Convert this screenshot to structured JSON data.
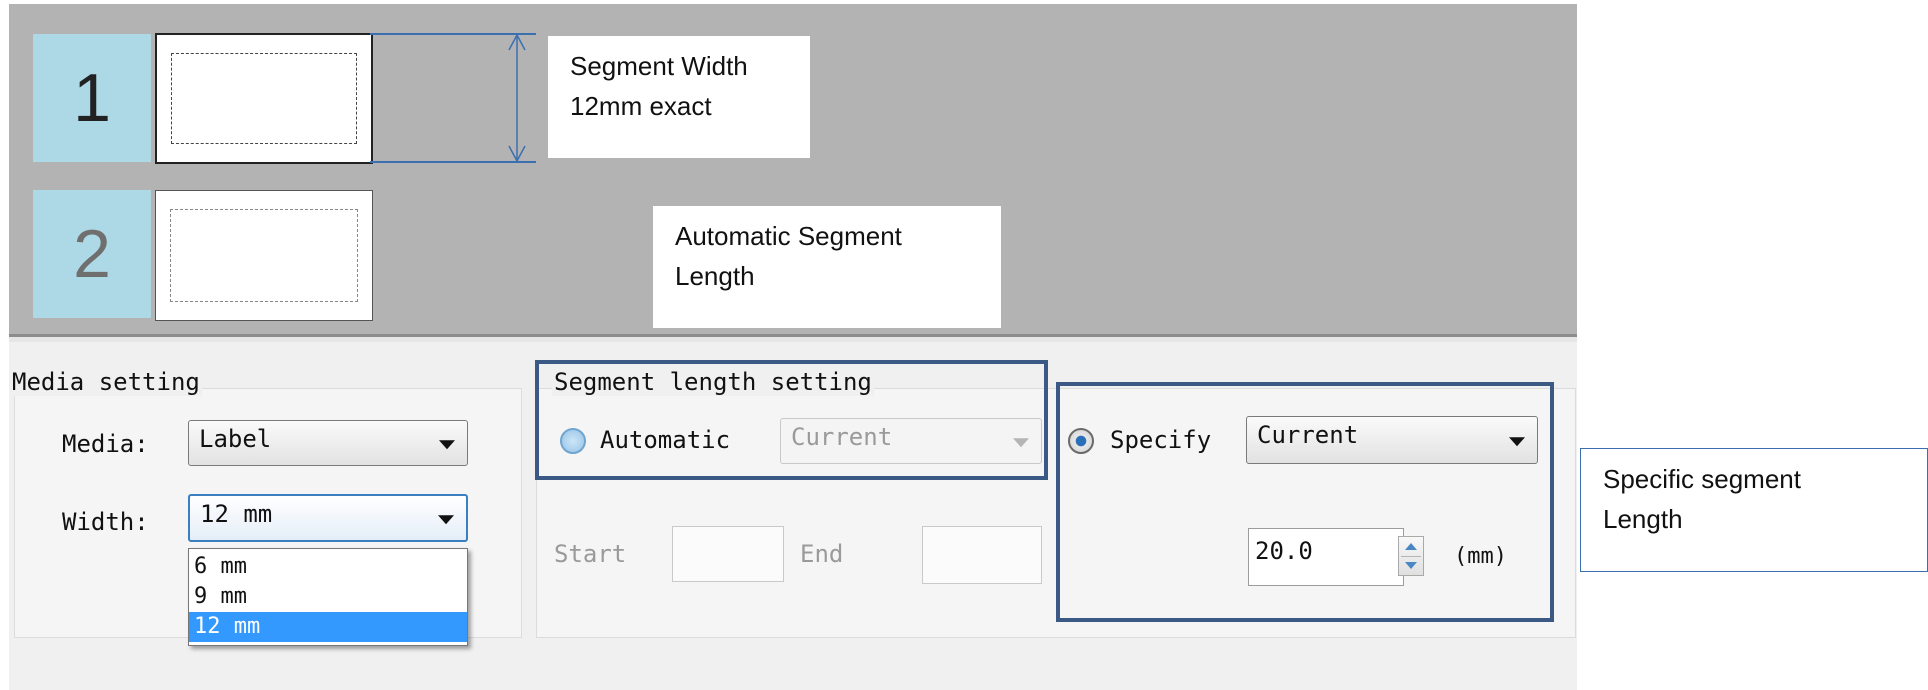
{
  "preview": {
    "segments": [
      {
        "number": "1"
      },
      {
        "number": "2"
      }
    ],
    "annotations": {
      "segment_width": [
        "Segment Width",
        "12mm exact"
      ],
      "automatic_length": [
        "Automatic Segment",
        "Length"
      ],
      "specific_length": [
        "Specific segment",
        "Length"
      ]
    }
  },
  "media_setting": {
    "title": "Media setting",
    "media_label": "Media:",
    "media_value": "Label",
    "width_label": "Width:",
    "width_value": "12 mm",
    "width_options": [
      "6 mm",
      "9 mm",
      "12 mm"
    ],
    "width_selected": "12 mm"
  },
  "segment_length_setting": {
    "title": "Segment length setting",
    "automatic_label": "Automatic",
    "automatic_value": "Current",
    "start_label": "Start",
    "start_value": "",
    "end_label": "End",
    "end_value": "",
    "specify_label": "Specify",
    "specify_value": "Current",
    "length_value": "20.0",
    "length_unit": "(mm)"
  },
  "colors": {
    "segment_number_bg": "#add8e6",
    "callout_border": "#3a5a85",
    "selection": "#3399ff"
  }
}
